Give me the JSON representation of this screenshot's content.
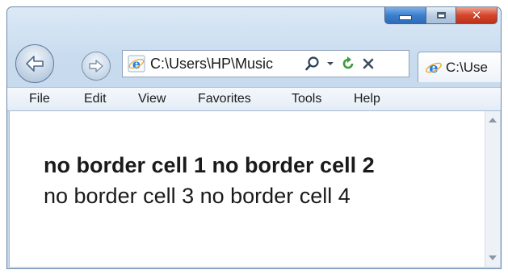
{
  "window": {
    "caption_buttons": {
      "minimize": "minimize",
      "maximize": "maximize",
      "close": "close"
    }
  },
  "nav": {
    "back_icon": "back-arrow-icon",
    "forward_icon": "forward-arrow-icon"
  },
  "address_bar": {
    "value": "C:\\Users\\HP\\Music",
    "icons": [
      "ie-logo-icon",
      "search-icon",
      "dropdown-icon",
      "refresh-icon",
      "stop-icon"
    ]
  },
  "tab": {
    "label": "C:\\Use"
  },
  "menu": {
    "items": [
      "File",
      "Edit",
      "View",
      "Favorites",
      "Tools",
      "Help"
    ]
  },
  "content": {
    "row1": "no border cell 1 no border cell 2",
    "row2": "no border cell 3 no border cell 4"
  },
  "colors": {
    "minimize_blue": "#3c7fcf",
    "close_red": "#d6452b",
    "ie_blue": "#2a7fd4",
    "refresh_green": "#3a9c3a"
  }
}
